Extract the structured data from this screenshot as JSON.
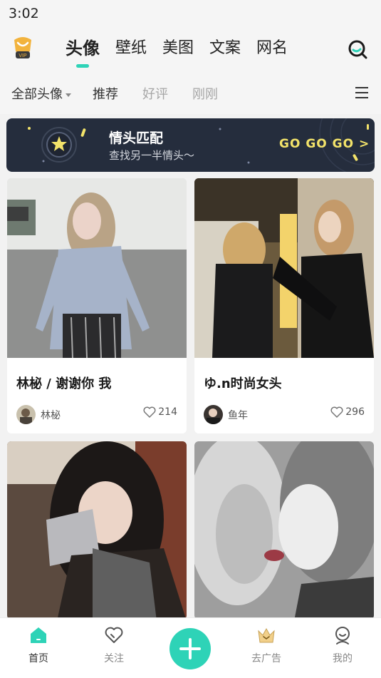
{
  "status_bar": {
    "time": "3:02"
  },
  "top_nav": {
    "vip_label": "VIP",
    "tabs": [
      {
        "label": "头像",
        "active": true
      },
      {
        "label": "壁纸",
        "active": false
      },
      {
        "label": "美图",
        "active": false
      },
      {
        "label": "文案",
        "active": false
      },
      {
        "label": "网名",
        "active": false
      }
    ],
    "search_icon": "search-icon",
    "accent_color": "#2ed3b7"
  },
  "sub_nav": {
    "filter_label": "全部头像",
    "tabs": [
      {
        "label": "推荐"
      },
      {
        "label": "好评"
      },
      {
        "label": "刚刚"
      }
    ],
    "menu_icon": "menu-icon"
  },
  "banner": {
    "title": "情头匹配",
    "subtitle": "查找另一半情头～",
    "cta": "GO GO GO >",
    "background": "#252d3d",
    "cta_color": "#f3e36a"
  },
  "feed": {
    "cards": [
      {
        "title": "林柲 / 谢谢你 我",
        "author": "林柲",
        "likes": "214"
      },
      {
        "title": "ゆ.n时尚女头",
        "author": "鱼年",
        "likes": "296"
      },
      {
        "title": "",
        "author": "",
        "likes": ""
      },
      {
        "title": "",
        "author": "",
        "likes": ""
      }
    ]
  },
  "bottom_nav": {
    "items": [
      {
        "label": "首页",
        "icon": "home-icon",
        "active": true
      },
      {
        "label": "关注",
        "icon": "heart-icon",
        "active": false
      },
      {
        "label": "",
        "icon": "plus-icon",
        "active": false
      },
      {
        "label": "去广告",
        "icon": "crown-icon",
        "active": false
      },
      {
        "label": "我的",
        "icon": "profile-icon",
        "active": false
      }
    ]
  }
}
